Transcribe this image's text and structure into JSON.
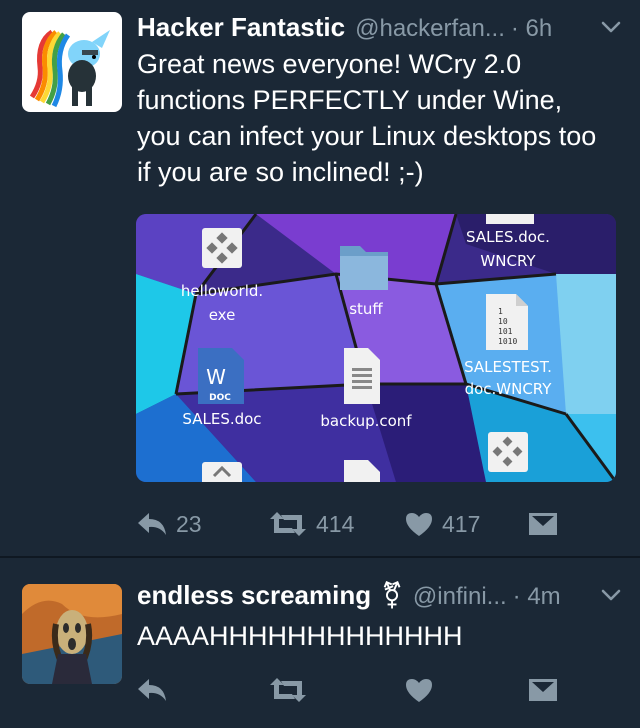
{
  "tweets": [
    {
      "display_name": "Hacker Fantastic",
      "handle": "@hackerfan...",
      "time": "· 6h",
      "text": "Great news everyone! WCry 2.0 functions PERFECTLY under Wine, you can infect your Linux desktops too if you are so inclined! ;-)",
      "reply_count": "23",
      "retweet_count": "414",
      "like_count": "417",
      "media": {
        "icons": [
          {
            "label_line1": "helloworld.",
            "label_line2": "exe"
          },
          {
            "label_line1": "stuff",
            "label_line2": ""
          },
          {
            "label_line1": "SALES.doc.",
            "label_line2": "WNCRY"
          },
          {
            "label_line1": "SALESTEST.",
            "label_line2": "doc.WNCRY"
          },
          {
            "label_line1": "SALES.doc",
            "label_line2": ""
          },
          {
            "label_line1": "backup.conf",
            "label_line2": ""
          }
        ],
        "word_badge": "W",
        "doc_badge": "DOC",
        "binary_text": [
          "1",
          "10",
          "101",
          "1010"
        ]
      }
    },
    {
      "display_name": "endless screaming",
      "gender_symbol": "⚧",
      "handle": "@infini...",
      "time": "· 4m",
      "text": "AAAAHHHHHHHHHHHHH"
    }
  ],
  "colors": {
    "background": "#1b2836",
    "muted": "#8899a6",
    "divider": "#0f1822"
  },
  "icons": [
    "reply-icon",
    "retweet-icon",
    "like-icon",
    "dm-icon",
    "chevron-down-icon"
  ]
}
